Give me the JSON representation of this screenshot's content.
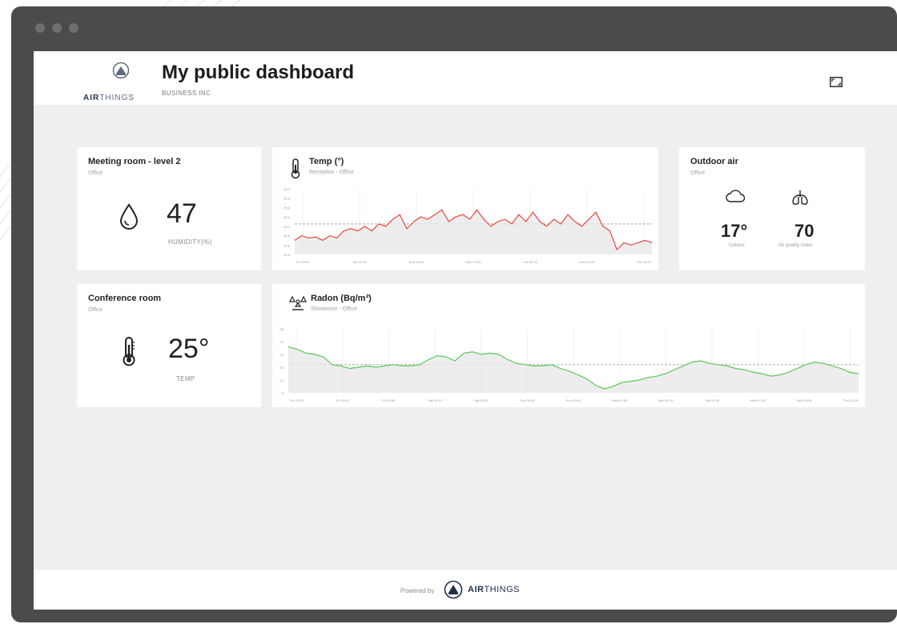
{
  "header": {
    "brand_bold": "AIR",
    "brand_light": "THINGS",
    "title": "My public dashboard",
    "company": "BUSINESS INC",
    "fullscreen_icon": "fullscreen-icon"
  },
  "tiles": {
    "meeting_room": {
      "title": "Meeting room - level 2",
      "subtitle": "Office",
      "icon": "humidity-drop-icon",
      "value": "47",
      "unit": "HUMIDITY(%)"
    },
    "conference_room": {
      "title": "Conference room",
      "subtitle": "Office",
      "icon": "thermometer-icon",
      "value": "25°",
      "unit": "TEMP"
    },
    "outdoor": {
      "title": "Outdoor air",
      "subtitle": "Office",
      "temp_icon": "cloud-icon",
      "temp_value": "17°",
      "temp_label": "Celsius",
      "aqi_icon": "lungs-icon",
      "aqi_value": "70",
      "aqi_label": "Air quality index"
    }
  },
  "temp_chart": {
    "title": "Temp (°)",
    "subtitle": "Reception - Office",
    "icon": "thermometer-icon",
    "color": "#e8473f"
  },
  "radon_chart": {
    "title": "Radon (Bq/m³)",
    "subtitle": "Showroom - Office",
    "icon": "radon-icon",
    "color": "#5cc85a"
  },
  "chart_data": [
    {
      "type": "line",
      "title": "Temp (°)",
      "x": [
        "Fri 20:00",
        "Sat 20:00",
        "Sun 20:00",
        "Mon 07:00",
        "Tue 20:00",
        "Wed 19:00",
        "Thu 12:00"
      ],
      "ylim": [
        24.6,
        26.0
      ],
      "y_ticks": [
        "26.0",
        "25.8",
        "25.6",
        "25.4",
        "25.2",
        "25.0",
        "24.8",
        "24.6"
      ],
      "reference_line": 25.25,
      "series": [
        {
          "values": [
            24.9,
            25.0,
            24.95,
            24.97,
            24.9,
            25.0,
            24.95,
            25.1,
            25.15,
            25.1,
            25.2,
            25.1,
            25.25,
            25.2,
            25.35,
            25.45,
            25.15,
            25.3,
            25.4,
            25.35,
            25.45,
            25.55,
            25.3,
            25.4,
            25.45,
            25.35,
            25.55,
            25.35,
            25.2,
            25.3,
            25.35,
            25.25,
            25.45,
            25.3,
            25.5,
            25.3,
            25.2,
            25.35,
            25.25,
            25.45,
            25.3,
            25.2,
            25.35,
            25.5,
            25.2,
            25.1,
            24.7,
            24.85,
            24.8,
            24.85,
            24.9,
            24.85
          ]
        }
      ]
    },
    {
      "type": "line",
      "title": "Radon (Bq/m³)",
      "x": [
        "Thu 20:00",
        "Fri 20:00",
        "Fri 20:00",
        "Sat 00:00",
        "Sat 20:00",
        "Sun 05:00",
        "Sun 20:00",
        "Mon 07:00",
        "Mon 07:00",
        "Tue 20:00",
        "Wed 07:00",
        "Wed 20:00",
        "Thu 12:00"
      ],
      "ylim": [
        0,
        50
      ],
      "y_ticks": [
        "50",
        "40",
        "30",
        "20",
        "10",
        "0"
      ],
      "reference_line": 22,
      "series": [
        {
          "values": [
            36,
            34,
            31,
            30,
            28,
            22,
            21,
            19,
            20,
            21,
            20,
            21,
            22,
            21,
            21,
            22,
            26,
            29,
            28,
            25,
            31,
            32,
            30,
            31,
            30,
            26,
            23,
            22,
            21,
            21,
            22,
            19,
            17,
            14,
            11,
            6,
            3,
            5,
            8,
            9,
            10,
            12,
            13,
            15,
            18,
            21,
            24,
            25,
            23,
            22,
            21,
            19,
            18,
            16,
            15,
            13,
            14,
            16,
            19,
            22,
            24,
            23,
            21,
            19,
            16,
            15
          ]
        }
      ]
    }
  ],
  "footer": {
    "powered_by": "Powered by",
    "brand_bold": "AIR",
    "brand_light": "THINGS"
  }
}
